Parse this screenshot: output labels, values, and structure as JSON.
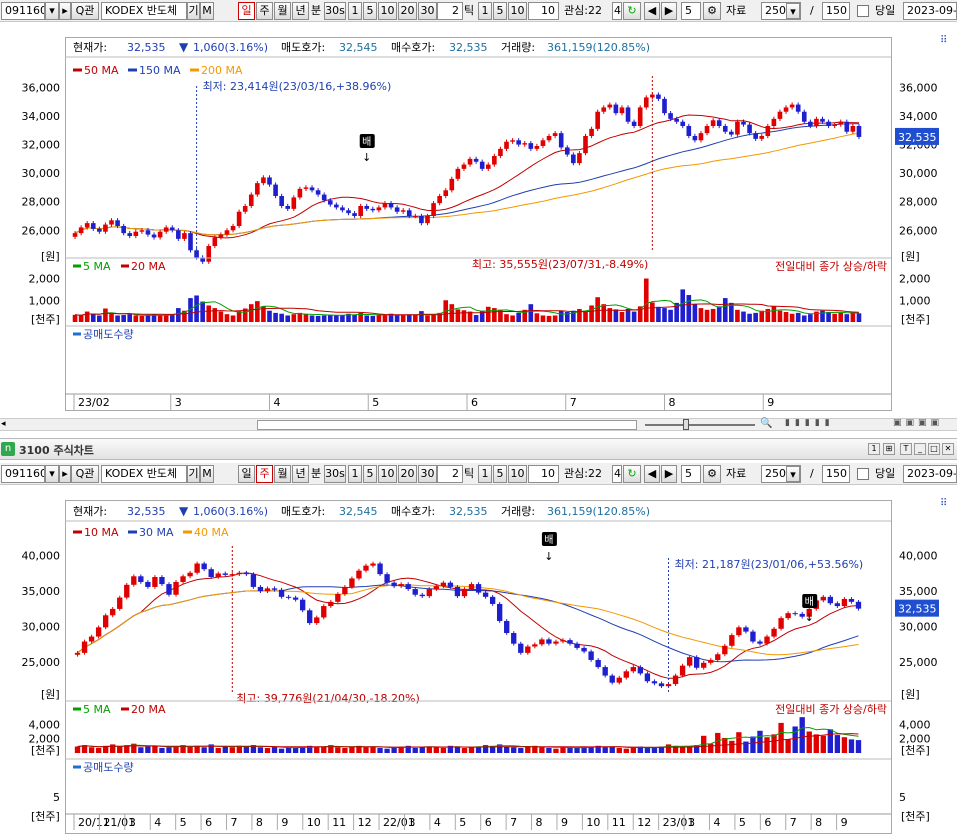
{
  "toolbar": {
    "code": "091160",
    "name": "KODEX 반도체",
    "search_q": "Q",
    "search_kwan": "관",
    "gi": "기",
    "m": "M",
    "periods": [
      "일",
      "주",
      "월",
      "년"
    ],
    "bun": "분",
    "minute_sel": "30s",
    "minutes": [
      "1",
      "5",
      "10",
      "20",
      "30"
    ],
    "tick_count": "2",
    "tick_label": "틱",
    "ticks": [
      "1",
      "5",
      "10"
    ],
    "tick_input": "10",
    "interest_label": "관심:22",
    "interest_num": "4",
    "step": "5",
    "data_label": "자료",
    "data_count": "250",
    "slash": "/",
    "total": "150",
    "today_label": "당일",
    "date": "2023-09-1"
  },
  "bottom_toolbar": {
    "date": "2023-09-1"
  },
  "window": {
    "badge": "n",
    "title": "3100 주식차트"
  },
  "quote": {
    "price_label": "현재가:",
    "price": "32,535",
    "change": "1,060(3.16%)",
    "ask_label": "매도호가:",
    "ask": "32,545",
    "bid_label": "매수호가:",
    "bid": "32,535",
    "volume_label": "거래량:",
    "volume": "361,159(120.85%)"
  },
  "chart_data": [
    {
      "type": "candlestick",
      "period": "daily",
      "legend": [
        {
          "name": "50 MA",
          "color": "#c00000"
        },
        {
          "name": "150 MA",
          "color": "#1f3fb0"
        },
        {
          "name": "200 MA",
          "color": "#f39800"
        }
      ],
      "y_ticks": [
        "36,000",
        "34,000",
        "32,000",
        "30,000",
        "28,000",
        "26,000"
      ],
      "y_unit": "[원]",
      "ylim": [
        24200,
        36800
      ],
      "x_labels": [
        "23/02",
        "3",
        "4",
        "5",
        "6",
        "7",
        "8",
        "9"
      ],
      "current_price": "32,535",
      "annotations": {
        "low": "최저: 23,414원(23/03/16,+38.96%)",
        "high": "최고: 35,555원(23/07/31,-8.49%)",
        "marker": "배"
      },
      "closes": [
        25800,
        26200,
        26500,
        26100,
        25900,
        26400,
        26700,
        26300,
        25800,
        25600,
        25900,
        26000,
        25700,
        25500,
        25900,
        26200,
        26000,
        25400,
        25800,
        24600,
        24100,
        23800,
        24900,
        25500,
        25700,
        26000,
        26300,
        27300,
        27700,
        28500,
        29300,
        29700,
        29200,
        28400,
        27700,
        27500,
        28300,
        28900,
        29000,
        28800,
        28500,
        28100,
        27800,
        27600,
        27400,
        27200,
        27000,
        27700,
        27500,
        27400,
        27600,
        27900,
        27600,
        27300,
        27400,
        27000,
        27000,
        26500,
        27000,
        27900,
        28400,
        28800,
        29600,
        30300,
        30600,
        31000,
        30800,
        30300,
        30600,
        31200,
        31700,
        32200,
        32300,
        32000,
        32100,
        31700,
        31900,
        32300,
        32600,
        32800,
        31800,
        31300,
        30700,
        31400,
        32600,
        33100,
        34300,
        34600,
        34800,
        34200,
        34600,
        33600,
        33300,
        34600,
        35300,
        35500,
        35200,
        34200,
        33800,
        33600,
        33300,
        32600,
        32300,
        32800,
        33300,
        33700,
        33300,
        32900,
        32700,
        33600,
        33400,
        32800,
        32400,
        32600,
        33300,
        33800,
        34300,
        34600,
        34800,
        34300,
        33600,
        33300,
        33800,
        33600,
        33300,
        33400,
        33600,
        32900,
        33300,
        32535
      ],
      "volume_ylim": [
        0,
        2300
      ],
      "volume_ticks": [
        "2,000",
        "1,000"
      ],
      "volume_unit": "[천주]",
      "volume_legend": [
        {
          "name": "5 MA",
          "color": "#00a000"
        },
        {
          "name": "20 MA",
          "color": "#c00000"
        }
      ],
      "volume_note": "전일대비 종가 상승/하락",
      "volumes": [
        330,
        300,
        480,
        360,
        300,
        620,
        380,
        300,
        320,
        360,
        300,
        280,
        300,
        350,
        300,
        330,
        360,
        640,
        520,
        1100,
        1220,
        940,
        760,
        640,
        480,
        360,
        300,
        500,
        620,
        820,
        960,
        720,
        520,
        420,
        380,
        300,
        360,
        420,
        360,
        300,
        280,
        300,
        340,
        320,
        300,
        380,
        320,
        420,
        300,
        280,
        300,
        330,
        380,
        300,
        300,
        340,
        320,
        500,
        300,
        320,
        420,
        1000,
        820,
        580,
        540,
        480,
        320,
        520,
        700,
        640,
        560,
        360,
        300,
        420,
        560,
        820,
        400,
        300,
        280,
        300,
        520,
        460,
        520,
        600,
        460,
        760,
        1140,
        820,
        640,
        580,
        460,
        600,
        480,
        720,
        2000,
        900,
        700,
        640,
        560,
        880,
        1500,
        1240,
        820,
        640,
        560,
        600,
        720,
        1100,
        880,
        560,
        480,
        380,
        420,
        520,
        600,
        720,
        520,
        460,
        380,
        420,
        300,
        360,
        480,
        520,
        460,
        380,
        420,
        360,
        480,
        400
      ],
      "short_sale_label": "공매도수량"
    },
    {
      "type": "candlestick",
      "period": "weekly",
      "legend": [
        {
          "name": "10 MA",
          "color": "#c00000"
        },
        {
          "name": "30 MA",
          "color": "#1f3fb0"
        },
        {
          "name": "40 MA",
          "color": "#f39800"
        }
      ],
      "y_ticks": [
        "40,000",
        "35,000",
        "30,000",
        "25,000"
      ],
      "y_unit": "[원]",
      "ylim": [
        20500,
        42500
      ],
      "x_labels": [
        "20/11",
        "21/01",
        "3",
        "4",
        "5",
        "6",
        "7",
        "8",
        "9",
        "10",
        "11",
        "12",
        "22/01",
        "3",
        "4",
        "5",
        "6",
        "7",
        "8",
        "9",
        "10",
        "11",
        "12",
        "23/01",
        "3",
        "4",
        "5",
        "6",
        "7",
        "8",
        "9"
      ],
      "current_price": "32,535",
      "annotations": {
        "low": "최저: 21,187원(23/01/06,+53.56%)",
        "high": "최고: 39,776원(21/04/30,-18.20%)",
        "marker_1": "배",
        "marker_2": "배"
      },
      "closes": [
        26300,
        27900,
        28600,
        29900,
        31600,
        32500,
        34100,
        35900,
        37100,
        36300,
        35600,
        37000,
        36000,
        34500,
        36300,
        37100,
        37600,
        38900,
        38100,
        37000,
        37500,
        37300,
        37400,
        37600,
        37400,
        35600,
        35000,
        35400,
        35200,
        34200,
        34100,
        33800,
        32300,
        30500,
        31300,
        32900,
        33500,
        34600,
        35600,
        36800,
        37900,
        38600,
        38900,
        37400,
        36200,
        35700,
        36000,
        35300,
        34500,
        34300,
        35300,
        35700,
        36200,
        35600,
        34300,
        35300,
        36000,
        34800,
        34200,
        33200,
        30800,
        29100,
        27600,
        26300,
        27200,
        27500,
        28200,
        27600,
        27900,
        28100,
        27600,
        27000,
        26500,
        25300,
        24300,
        23100,
        22100,
        22800,
        23700,
        24300,
        23400,
        22300,
        22000,
        21600,
        21900,
        23100,
        24500,
        25700,
        24200,
        24900,
        25300,
        26100,
        27300,
        28800,
        29900,
        29300,
        27900,
        27600,
        28600,
        29700,
        31200,
        31900,
        31800,
        31400,
        32500,
        33700,
        34200,
        33300,
        32900,
        33900,
        33500,
        32535
      ],
      "volume_ylim": [
        0,
        5300
      ],
      "volume_ticks": [
        "4,000",
        "2,000"
      ],
      "volume_unit": "[천주]",
      "volume_legend": [
        {
          "name": "5 MA",
          "color": "#00a000"
        },
        {
          "name": "20 MA",
          "color": "#c00000"
        }
      ],
      "volume_note": "전일대비 종가 상승/하락",
      "volumes": [
        900,
        1100,
        800,
        700,
        1000,
        1200,
        900,
        1100,
        1300,
        800,
        900,
        1000,
        700,
        800,
        900,
        1100,
        900,
        1000,
        800,
        1200,
        700,
        900,
        800,
        1000,
        900,
        1100,
        800,
        700,
        900,
        600,
        800,
        700,
        900,
        1000,
        800,
        900,
        1100,
        800,
        700,
        900,
        1000,
        800,
        900,
        700,
        600,
        800,
        900,
        1000,
        700,
        800,
        900,
        800,
        700,
        1000,
        900,
        700,
        800,
        900,
        1100,
        1000,
        1200,
        900,
        800,
        700,
        900,
        1000,
        800,
        700,
        600,
        900,
        800,
        700,
        800,
        900,
        1000,
        800,
        900,
        700,
        600,
        800,
        900,
        700,
        800,
        900,
        1200,
        1000,
        800,
        900,
        1100,
        2400,
        1300,
        2800,
        2100,
        1700,
        2900,
        1600,
        2300,
        3100,
        2200,
        2600,
        4200,
        1900,
        3700,
        5000,
        3000,
        2600,
        2400,
        3300,
        2500,
        2200,
        1900,
        1800
      ],
      "short_sale_label": "공매도수량",
      "short_sale_ticks": [
        "5",
        "5"
      ],
      "short_sale_unit": "[천주]"
    }
  ]
}
